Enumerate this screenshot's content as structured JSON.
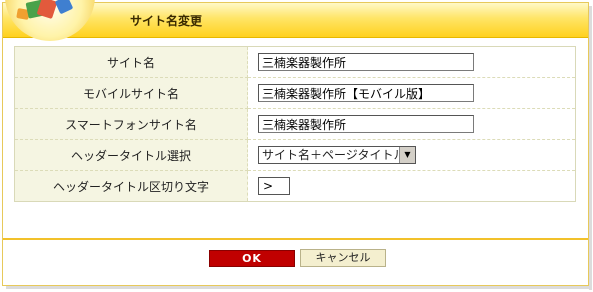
{
  "header": {
    "title": "サイト名変更"
  },
  "form": {
    "rows": [
      {
        "label": "サイト名",
        "value": "三楠楽器製作所"
      },
      {
        "label": "モバイルサイト名",
        "value": "三楠楽器製作所【モバイル版】"
      },
      {
        "label": "スマートフォンサイト名",
        "value": "三楠楽器製作所"
      },
      {
        "label": "ヘッダータイトル選択",
        "selected": "サイト名＋ページタイトル"
      },
      {
        "label": "ヘッダータイトル区切り文字",
        "value": ">"
      }
    ]
  },
  "buttons": {
    "ok": "OK",
    "cancel": "キャンセル"
  },
  "colors": {
    "header": "#ffd11f",
    "ok": "#c00000",
    "label_bg": "#f5f5e2"
  }
}
